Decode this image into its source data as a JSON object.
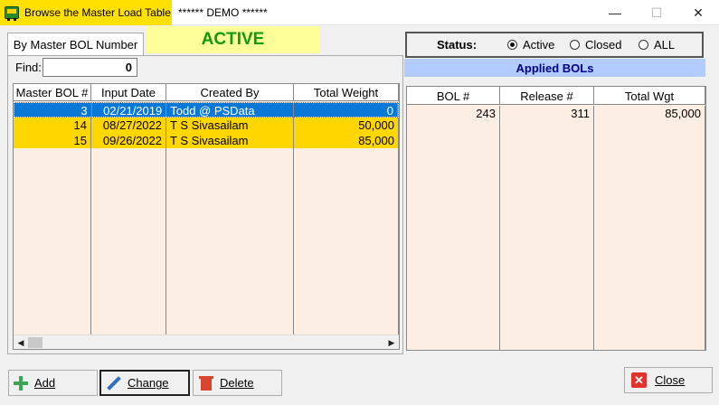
{
  "window": {
    "title": "Browse the Master Load Table",
    "demo_label": "****** DEMO ******",
    "minimize": "—",
    "maximize": "☐",
    "close": "✕"
  },
  "left": {
    "tab_label": "By Master BOL Number",
    "banner": "ACTIVE",
    "find_label": "Find:",
    "find_value": "0",
    "columns": [
      "Master BOL #",
      "Input Date",
      "Created By",
      "Total Weight"
    ],
    "rows": [
      {
        "bol": "3",
        "date": "02/21/2019",
        "created_by": "Todd @ PSData",
        "weight": "0"
      },
      {
        "bol": "14",
        "date": "08/27/2022",
        "created_by": "T S Sivasailam",
        "weight": "50,000"
      },
      {
        "bol": "15",
        "date": "09/26/2022",
        "created_by": "T S Sivasailam",
        "weight": "85,000"
      }
    ],
    "scroll_left": "◀",
    "scroll_right": "▶"
  },
  "status": {
    "label": "Status:",
    "options": [
      "Active",
      "Closed",
      "ALL"
    ],
    "selected": "Active"
  },
  "right": {
    "header": "Applied BOLs",
    "columns": [
      "BOL #",
      "Release #",
      "Total Wgt"
    ],
    "rows": [
      {
        "bol": "243",
        "release": "311",
        "wgt": "85,000"
      }
    ]
  },
  "buttons": {
    "add": "Add",
    "change": "Change",
    "delete": "Delete",
    "close": "Close",
    "close_icon": "✕"
  },
  "colors": {
    "title_yellow": "#ffe000",
    "banner_bg": "#ffff99",
    "banner_text": "#119911",
    "selected_row": "#0a78d7",
    "highlight_row": "#ffd700",
    "grid_bg": "#fdeee3",
    "applied_bg": "#b2ccff",
    "applied_text": "#00008b"
  }
}
